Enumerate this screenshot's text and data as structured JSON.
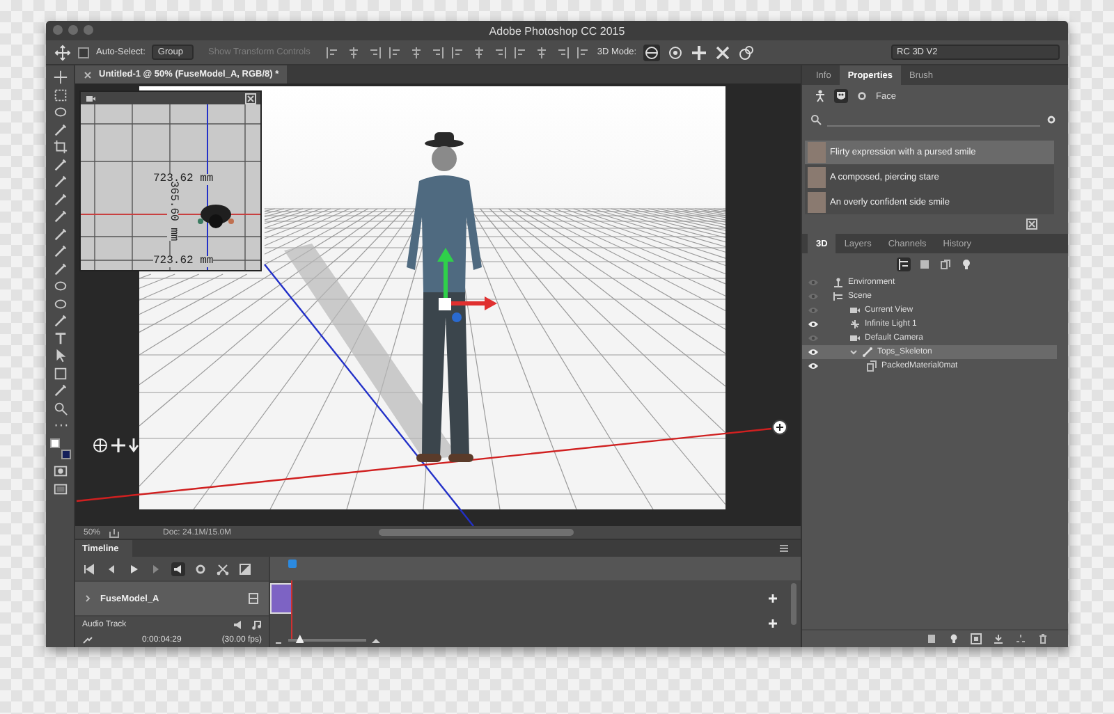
{
  "window": {
    "title": "Adobe Photoshop CC 2015"
  },
  "options_bar": {
    "auto_select": {
      "label": "Auto-Select:",
      "checked": false
    },
    "auto_select_target": "Group",
    "transform_controls": {
      "label": "Show Transform Controls",
      "disabled": true
    },
    "mode_label": "3D Mode:",
    "workspace": "RC 3D V2"
  },
  "document_tab": {
    "title": "Untitled-1 @ 50% (FuseModel_A, RGB/8) *",
    "selected": true
  },
  "inset_view": {
    "measure_top": "723.62 mm",
    "measure_side": "365.60 mm",
    "measure_bottom": "723.62 mm"
  },
  "status_bar": {
    "zoom": "50%",
    "doc": "Doc: 24.1M/15.0M"
  },
  "timeline": {
    "tab": "Timeline",
    "track": "FuseModel_A",
    "audio_track": "Audio Track",
    "timecode": "0:00:04:29",
    "fps": "(30.00 fps)",
    "zoom_slider": {
      "level": 0.15
    }
  },
  "properties_panel": {
    "tabs": [
      {
        "label": "Info",
        "selected": false
      },
      {
        "label": "Properties",
        "selected": true
      },
      {
        "label": "Brush",
        "selected": false
      }
    ],
    "section": "Face",
    "expressions": [
      {
        "label": "Flirty expression with a pursed smile",
        "selected": true
      },
      {
        "label": "A composed, piercing stare",
        "selected": false
      },
      {
        "label": "An overly confident side smile",
        "selected": false
      }
    ]
  },
  "scene_panel": {
    "tabs": [
      {
        "label": "3D",
        "selected": true
      },
      {
        "label": "Layers",
        "selected": false
      },
      {
        "label": "Channels",
        "selected": false
      },
      {
        "label": "History",
        "selected": false
      }
    ],
    "tree": [
      {
        "label": "Environment",
        "kind": "environment",
        "visible": false,
        "selected": false
      },
      {
        "label": "Scene",
        "kind": "scene",
        "visible": false,
        "selected": false,
        "children": [
          {
            "label": "Current View",
            "kind": "camera",
            "visible": false,
            "selected": false
          },
          {
            "label": "Infinite Light 1",
            "kind": "light",
            "visible": true,
            "selected": false
          },
          {
            "label": "Default Camera",
            "kind": "camera",
            "visible": false,
            "selected": false
          },
          {
            "label": "Tops_Skeleton",
            "kind": "mesh",
            "visible": true,
            "selected": true,
            "expanded": true,
            "children": [
              {
                "label": "PackedMaterial0mat",
                "kind": "material",
                "visible": true,
                "selected": false
              }
            ]
          }
        ]
      }
    ]
  }
}
